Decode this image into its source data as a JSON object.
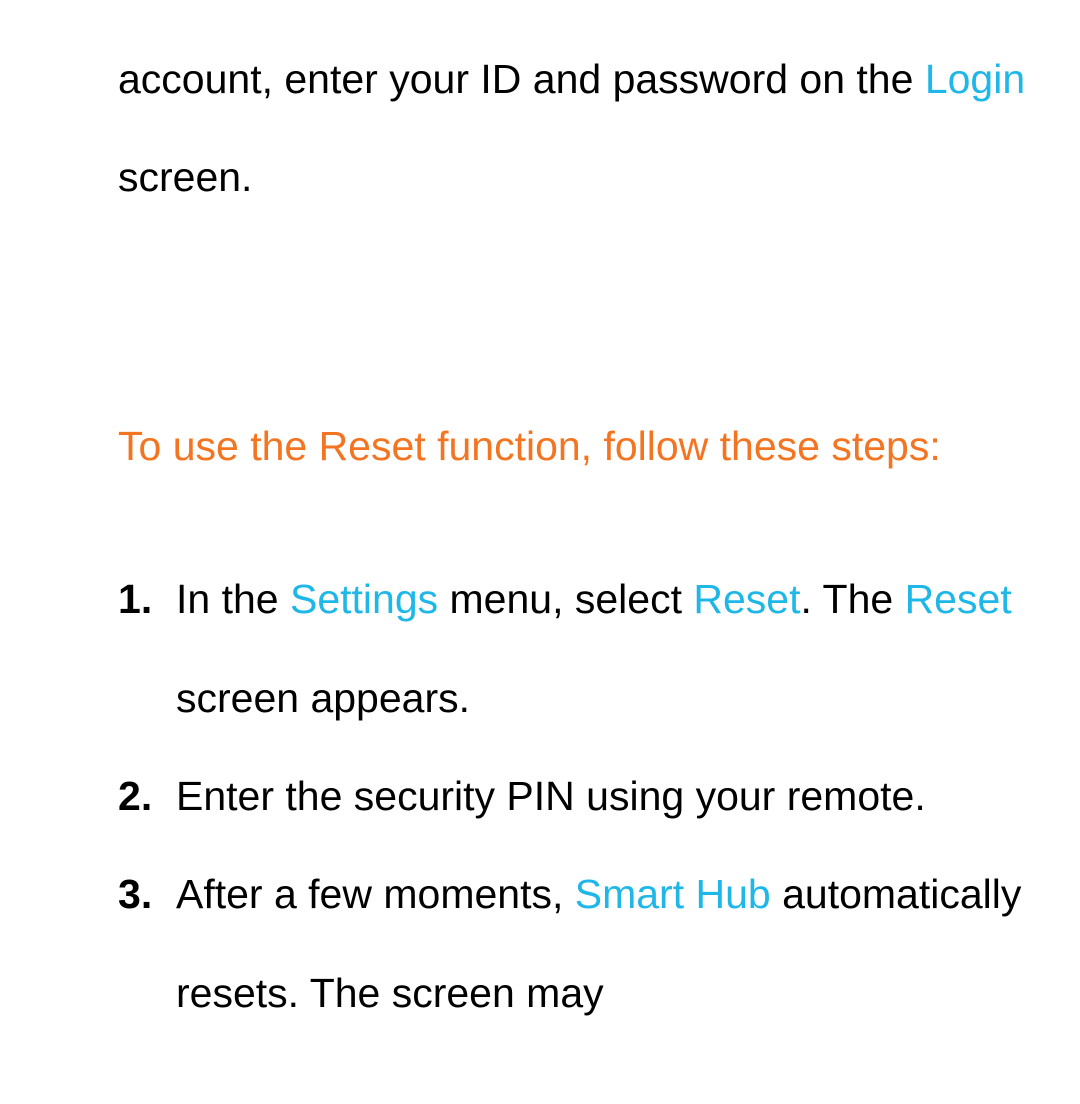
{
  "intro": {
    "text_before_login": "account, enter your ID and password on the ",
    "login_keyword": "Login",
    "text_after_login": " screen."
  },
  "heading": "To use the Reset function, follow these steps:",
  "steps": {
    "step1": {
      "t1": "In the ",
      "settings_kw": "Settings",
      "t2": " menu, select ",
      "reset_kw1": "Reset",
      "t3": ". The ",
      "reset_kw2": "Reset",
      "t4": " screen appears."
    },
    "step2": {
      "t1": "Enter the security PIN using your remote."
    },
    "step3": {
      "t1": "After a few moments, ",
      "smarthub_kw": "Smart Hub",
      "t2": " automatically resets. The screen may"
    }
  }
}
